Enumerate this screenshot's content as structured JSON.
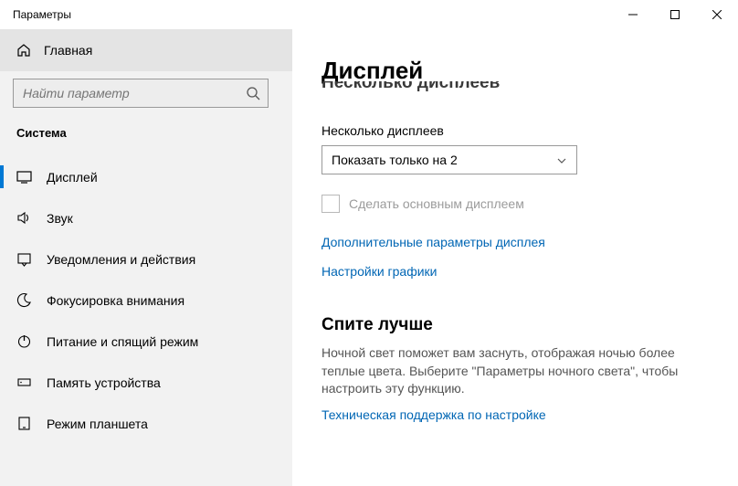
{
  "window": {
    "title": "Параметры"
  },
  "sidebar": {
    "home": "Главная",
    "search_placeholder": "Найти параметр",
    "section": "Система",
    "items": [
      {
        "label": "Дисплей"
      },
      {
        "label": "Звук"
      },
      {
        "label": "Уведомления и действия"
      },
      {
        "label": "Фокусировка внимания"
      },
      {
        "label": "Питание и спящий режим"
      },
      {
        "label": "Память устройства"
      },
      {
        "label": "Режим планшета"
      }
    ]
  },
  "main": {
    "title": "Дисплей",
    "cut_heading": "Несколько дисплеев",
    "multi_label": "Несколько дисплеев",
    "dropdown_value": "Показать только на 2",
    "checkbox_label": "Сделать основным дисплеем",
    "link_advanced": "Дополнительные параметры дисплея",
    "link_graphics": "Настройки графики",
    "sleep_heading": "Спите лучше",
    "sleep_text": "Ночной свет поможет вам заснуть, отображая ночью более теплые цвета. Выберите \"Параметры ночного света\", чтобы настроить эту функцию.",
    "link_support": "Техническая поддержка по настройке"
  }
}
